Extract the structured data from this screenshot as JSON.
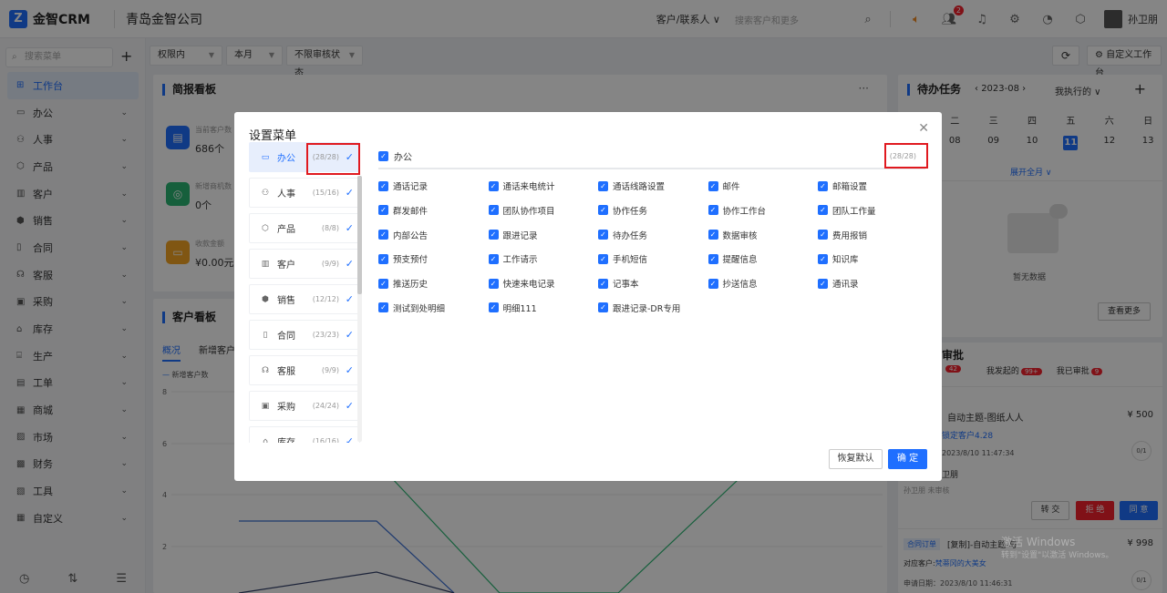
{
  "app": {
    "brand": "金智CRM",
    "company": "青岛金智公司",
    "logo_letter": "Z"
  },
  "topbar": {
    "scope": "客户/联系人 ∨",
    "search_placeholder": "搜索客户和更多",
    "notify_badge": "2",
    "user": "孙卫朋"
  },
  "sidebar": {
    "search_placeholder": "搜索菜单",
    "items": [
      {
        "label": "工作台",
        "icon": "grid-icon",
        "active": true
      },
      {
        "label": "办公",
        "icon": "inbox-icon"
      },
      {
        "label": "人事",
        "icon": "people-icon"
      },
      {
        "label": "产品",
        "icon": "cube-icon"
      },
      {
        "label": "客户",
        "icon": "chart-icon"
      },
      {
        "label": "销售",
        "icon": "hexagon-icon"
      },
      {
        "label": "合同",
        "icon": "document-icon"
      },
      {
        "label": "客服",
        "icon": "headset-icon"
      },
      {
        "label": "采购",
        "icon": "bag-icon"
      },
      {
        "label": "库存",
        "icon": "warehouse-icon"
      },
      {
        "label": "生产",
        "icon": "factory-icon"
      },
      {
        "label": "工单",
        "icon": "ticket-icon"
      },
      {
        "label": "商城",
        "icon": "shop-icon"
      },
      {
        "label": "市场",
        "icon": "market-icon"
      },
      {
        "label": "财务",
        "icon": "finance-icon"
      },
      {
        "label": "工具",
        "icon": "tool-icon"
      },
      {
        "label": "自定义",
        "icon": "custom-icon"
      }
    ]
  },
  "filters": [
    "权限内",
    "本月",
    "不限审核状态"
  ],
  "buttons": {
    "custom_workspace": "自定义工作台"
  },
  "brief_board": {
    "title": "简报看板",
    "kpis": [
      {
        "label": "当前客户数",
        "value": "686个",
        "color": "#1f6fff"
      },
      {
        "label": "新增商机数",
        "value": "0个",
        "color": "#2bb673"
      },
      {
        "label": "收款金额",
        "value": "¥0.00元",
        "color": "#f5a623"
      }
    ]
  },
  "customer_board": {
    "title": "客户看板",
    "tabs": [
      "概况",
      "新增客户"
    ],
    "legend": "新增客户数",
    "y_ticks": [
      "8",
      "6",
      "4",
      "2"
    ]
  },
  "todo": {
    "title": "待办任务",
    "month": "2023-08",
    "filter": "我执行的",
    "weekdays": [
      "二",
      "三",
      "四",
      "五",
      "六",
      "日"
    ],
    "days": [
      "08",
      "09",
      "10",
      "11",
      "12",
      "13"
    ],
    "expand": "展开全月",
    "empty": "暂无数据",
    "more": "查看更多"
  },
  "approval": {
    "title": "审批",
    "tabs": [
      {
        "label": "",
        "badge": "42"
      },
      {
        "label": "我发起的",
        "badge": "99+"
      },
      {
        "label": "我已审批",
        "badge": "9"
      }
    ],
    "item1": {
      "title": "自动主题-图纸人人",
      "amount": "¥ 500",
      "customer": "锁定客户4.28",
      "date": "2023/8/10 11:47:34",
      "progress": "0/1",
      "person": "卫朋",
      "status": "孙卫朋 未审核"
    },
    "actions": [
      "转 交",
      "拒 绝",
      "同 意"
    ],
    "item2": {
      "tag": "合同订单",
      "title": "[复制]-自动主题-与",
      "amount": "¥ 998",
      "customer_label": "对应客户:",
      "customer": "梵蒂冈的大美女",
      "date": "申请日期：2023/8/10 11:46:31",
      "progress": "0/1"
    }
  },
  "modal": {
    "title": "设置菜单",
    "modules": [
      {
        "label": "办公",
        "count": "(28/28)",
        "icon": "inbox-icon",
        "selected": true
      },
      {
        "label": "人事",
        "count": "(15/16)",
        "icon": "people-icon"
      },
      {
        "label": "产品",
        "count": "(8/8)",
        "icon": "cube-icon"
      },
      {
        "label": "客户",
        "count": "(9/9)",
        "icon": "chart-icon"
      },
      {
        "label": "销售",
        "count": "(12/12)",
        "icon": "hexagon-icon"
      },
      {
        "label": "合同",
        "count": "(23/23)",
        "icon": "document-icon"
      },
      {
        "label": "客服",
        "count": "(9/9)",
        "icon": "headset-icon"
      },
      {
        "label": "采购",
        "count": "(24/24)",
        "icon": "bag-icon"
      },
      {
        "label": "库存",
        "count": "(16/16)",
        "icon": "warehouse-icon"
      }
    ],
    "section_label": "办公",
    "section_count": "(28/28)",
    "permissions": [
      "通话记录",
      "通话来电统计",
      "通话线路设置",
      "邮件",
      "邮箱设置",
      "群发邮件",
      "团队协作项目",
      "协作任务",
      "协作工作台",
      "团队工作量",
      "内部公告",
      "跟进记录",
      "待办任务",
      "数据审核",
      "费用报销",
      "预支预付",
      "工作请示",
      "手机短信",
      "提醒信息",
      "知识库",
      "推送历史",
      "快速来电记录",
      "记事本",
      "抄送信息",
      "通讯录",
      "测试到处明细",
      "明细111",
      "跟进记录-DR专用"
    ],
    "reset": "恢复默认",
    "confirm": "确 定"
  },
  "watermark": {
    "line1": "激活 Windows",
    "line2": "转到\"设置\"以激活 Windows。"
  }
}
